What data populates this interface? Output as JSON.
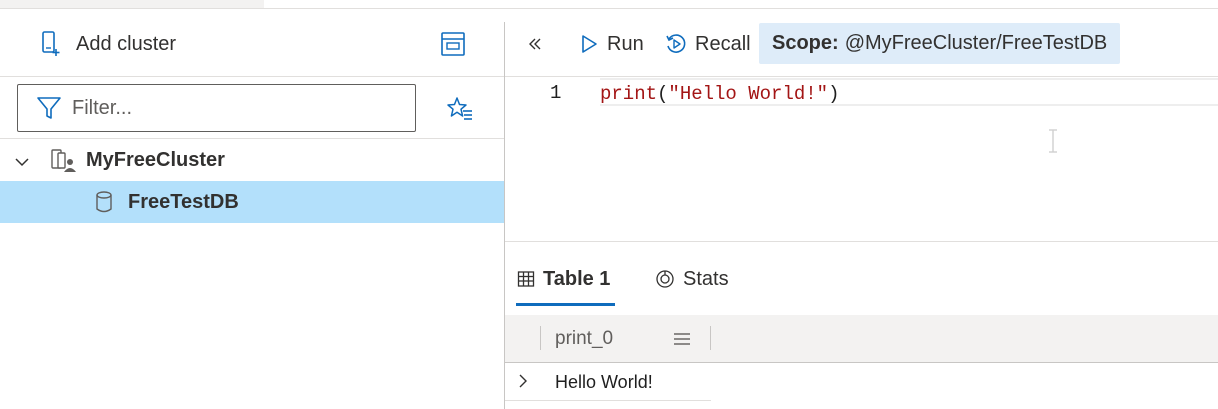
{
  "left_panel": {
    "add_cluster_label": "Add cluster",
    "filter_placeholder": "Filter...",
    "tree": {
      "cluster_name": "MyFreeCluster",
      "database_name": "FreeTestDB"
    }
  },
  "query_toolbar": {
    "run_label": "Run",
    "recall_label": "Recall",
    "scope_key": "Scope:",
    "scope_value": "@MyFreeCluster/FreeTestDB"
  },
  "editor": {
    "line_number": "1",
    "code": {
      "fn": "print",
      "open": "(",
      "str": "\"Hello World!\"",
      "close": ")"
    }
  },
  "results": {
    "tabs": [
      {
        "label": "Table 1",
        "icon": "table-icon",
        "selected": true
      },
      {
        "label": "Stats",
        "icon": "stats-icon",
        "selected": false
      }
    ],
    "columns": [
      "print_0"
    ],
    "rows": [
      [
        "Hello World!"
      ]
    ]
  },
  "colors": {
    "accent": "#0f6cbd",
    "selected_row": "#b3e0fb",
    "scope_chip": "#deecf9",
    "code_red": "#a31515"
  }
}
